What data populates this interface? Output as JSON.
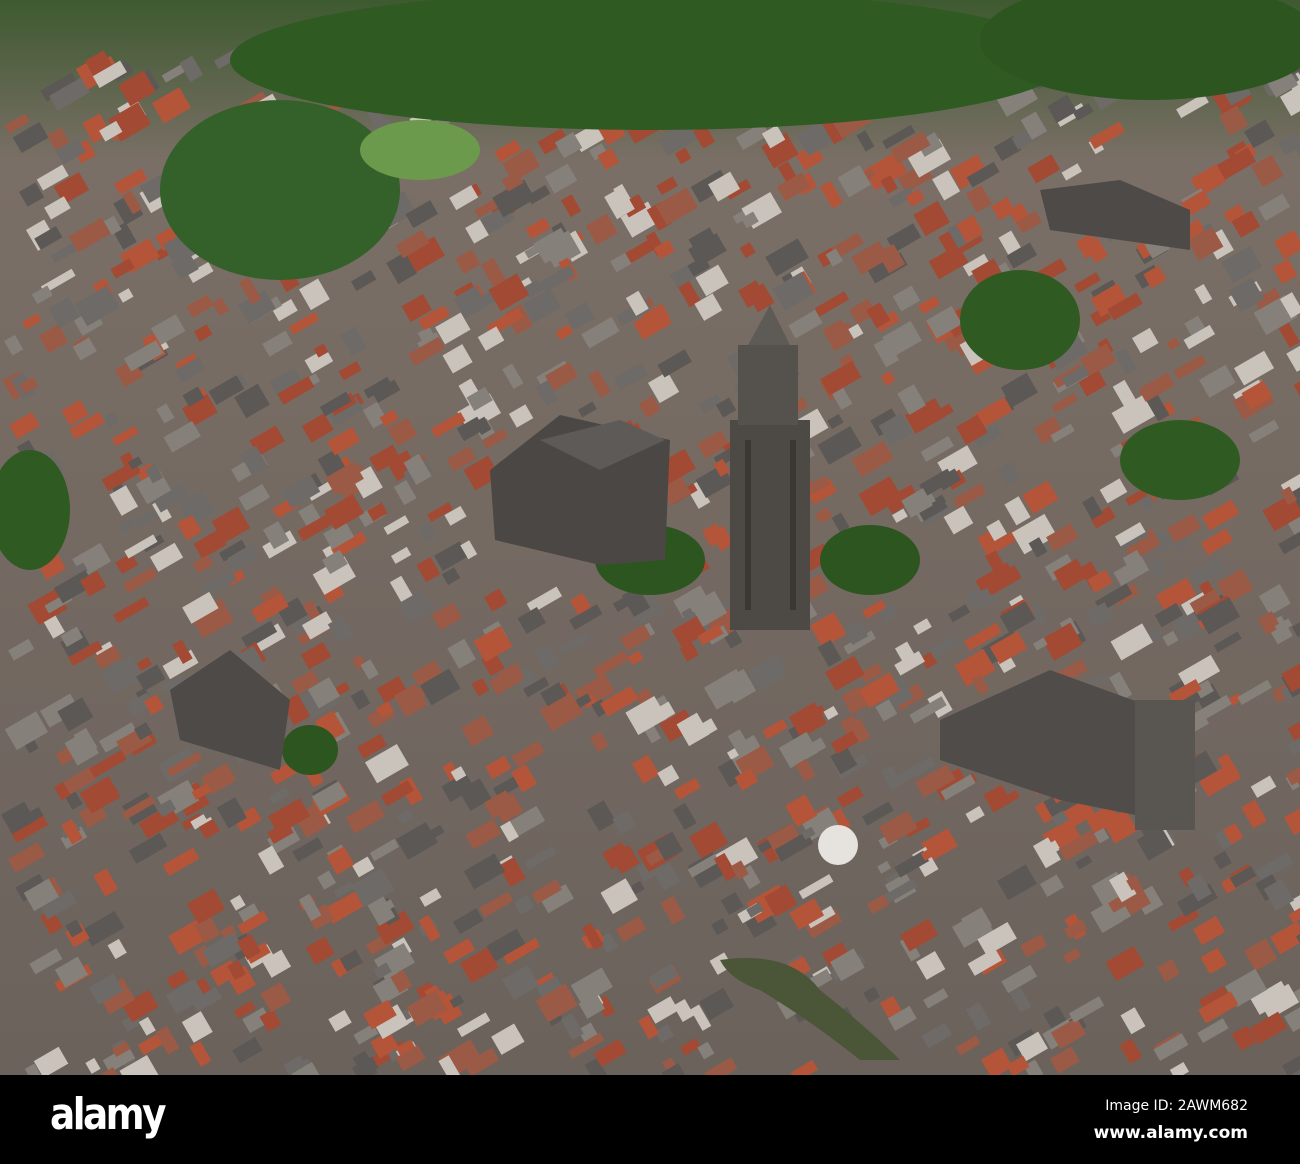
{
  "photo": {
    "subject": "aerial-city",
    "colors": {
      "green": "#2f5a22",
      "roof_red": "#b4553a",
      "roof_gray": "#6d6a68",
      "street": "#8f8a82",
      "tower": "#4d4a46",
      "water": "#4b5538"
    }
  },
  "watermark": {
    "logo": "alamy",
    "image_id": "Image ID: 2AWM682",
    "website": "www.alamy.com"
  }
}
